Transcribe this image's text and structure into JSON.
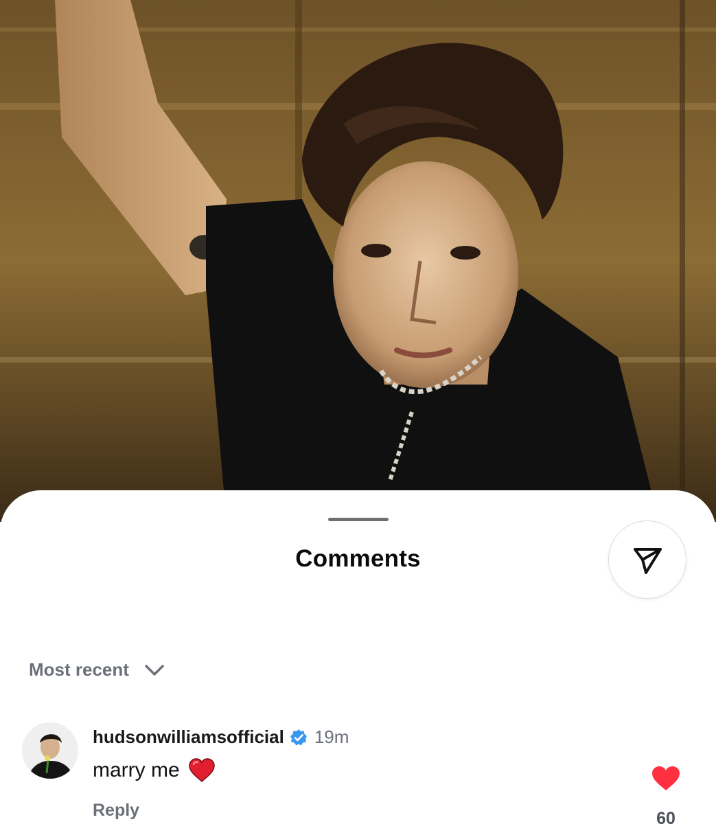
{
  "sheet": {
    "title": "Comments",
    "share_icon": "send-icon"
  },
  "sort": {
    "label": "Most recent",
    "icon": "chevron-down-icon"
  },
  "comment": {
    "username": "hudsonwilliamsofficial",
    "verified": true,
    "timestamp": "19m",
    "text": "marry me",
    "emoji_icon": "red-heart-icon",
    "reply_label": "Reply",
    "like_icon": "heart-filled-icon",
    "like_count": "60"
  },
  "colors": {
    "verified_blue": "#3897f0",
    "heart_red": "#ff3040",
    "muted_text": "#6b7079"
  }
}
